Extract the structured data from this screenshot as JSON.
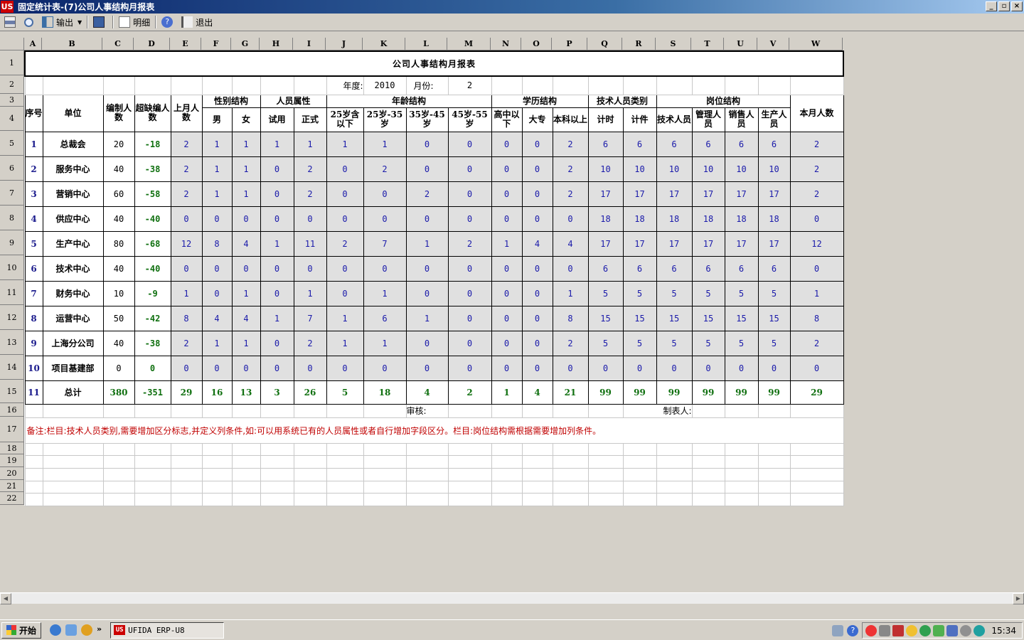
{
  "window": {
    "title": "固定统计表-(7)公司人事结构月报表",
    "logo": "US"
  },
  "toolbar": {
    "export_label": "输出",
    "detail_label": "明细",
    "exit_label": "退出"
  },
  "columns": [
    "A",
    "B",
    "C",
    "D",
    "E",
    "F",
    "G",
    "H",
    "I",
    "J",
    "K",
    "L",
    "M",
    "N",
    "O",
    "P",
    "Q",
    "R",
    "S",
    "T",
    "U",
    "V",
    "W"
  ],
  "rows": [
    "1",
    "2",
    "3",
    "4",
    "5",
    "6",
    "7",
    "8",
    "9",
    "10",
    "11",
    "12",
    "13",
    "14",
    "15",
    "16",
    "17",
    "18",
    "19",
    "20",
    "21",
    "22"
  ],
  "report": {
    "title": "公司人事结构月报表",
    "year_label": "年度:",
    "year": "2010",
    "month_label": "月份:",
    "month": "2",
    "headers": {
      "seq": "序号",
      "unit": "单位",
      "budget": "编制人数",
      "over": "超缺编人数",
      "last_month": "上月人数",
      "gender": "性别结构",
      "male": "男",
      "female": "女",
      "attr": "人员属性",
      "trial": "试用",
      "regular": "正式",
      "age": "年龄结构",
      "age1": "25岁含以下",
      "age2": "25岁-35岁",
      "age3": "35岁-45岁",
      "age4": "45岁-55岁",
      "edu": "学历结构",
      "edu1": "高中以下",
      "edu2": "大专",
      "edu3": "本科以上",
      "tech": "技术人员类别",
      "tech1": "计时",
      "tech2": "计件",
      "post": "岗位结构",
      "post1": "技术人员",
      "post2": "管理人员",
      "post3": "销售人员",
      "post4": "生产人员",
      "this_month": "本月人数"
    },
    "data_rows": [
      {
        "seq": "1",
        "unit": "总裁会",
        "v": [
          "20",
          "-18",
          "2",
          "1",
          "1",
          "1",
          "1",
          "1",
          "1",
          "0",
          "0",
          "0",
          "0",
          "2",
          "6",
          "6",
          "6",
          "6",
          "6",
          "6",
          "2"
        ]
      },
      {
        "seq": "2",
        "unit": "服务中心",
        "v": [
          "40",
          "-38",
          "2",
          "1",
          "1",
          "0",
          "2",
          "0",
          "2",
          "0",
          "0",
          "0",
          "0",
          "2",
          "10",
          "10",
          "10",
          "10",
          "10",
          "10",
          "2"
        ]
      },
      {
        "seq": "3",
        "unit": "营销中心",
        "v": [
          "60",
          "-58",
          "2",
          "1",
          "1",
          "0",
          "2",
          "0",
          "0",
          "2",
          "0",
          "0",
          "0",
          "2",
          "17",
          "17",
          "17",
          "17",
          "17",
          "17",
          "2"
        ]
      },
      {
        "seq": "4",
        "unit": "供应中心",
        "v": [
          "40",
          "-40",
          "0",
          "0",
          "0",
          "0",
          "0",
          "0",
          "0",
          "0",
          "0",
          "0",
          "0",
          "0",
          "18",
          "18",
          "18",
          "18",
          "18",
          "18",
          "0"
        ]
      },
      {
        "seq": "5",
        "unit": "生产中心",
        "v": [
          "80",
          "-68",
          "12",
          "8",
          "4",
          "1",
          "11",
          "2",
          "7",
          "1",
          "2",
          "1",
          "4",
          "4",
          "17",
          "17",
          "17",
          "17",
          "17",
          "17",
          "12"
        ]
      },
      {
        "seq": "6",
        "unit": "技术中心",
        "v": [
          "40",
          "-40",
          "0",
          "0",
          "0",
          "0",
          "0",
          "0",
          "0",
          "0",
          "0",
          "0",
          "0",
          "0",
          "6",
          "6",
          "6",
          "6",
          "6",
          "6",
          "0"
        ]
      },
      {
        "seq": "7",
        "unit": "财务中心",
        "v": [
          "10",
          "-9",
          "1",
          "0",
          "1",
          "0",
          "1",
          "0",
          "1",
          "0",
          "0",
          "0",
          "0",
          "1",
          "5",
          "5",
          "5",
          "5",
          "5",
          "5",
          "1"
        ]
      },
      {
        "seq": "8",
        "unit": "运营中心",
        "v": [
          "50",
          "-42",
          "8",
          "4",
          "4",
          "1",
          "7",
          "1",
          "6",
          "1",
          "0",
          "0",
          "0",
          "8",
          "15",
          "15",
          "15",
          "15",
          "15",
          "15",
          "8"
        ]
      },
      {
        "seq": "9",
        "unit": "上海分公司",
        "v": [
          "40",
          "-38",
          "2",
          "1",
          "1",
          "0",
          "2",
          "1",
          "1",
          "0",
          "0",
          "0",
          "0",
          "2",
          "5",
          "5",
          "5",
          "5",
          "5",
          "5",
          "2"
        ]
      },
      {
        "seq": "10",
        "unit": "项目基建部",
        "v": [
          "0",
          "0",
          "0",
          "0",
          "0",
          "0",
          "0",
          "0",
          "0",
          "0",
          "0",
          "0",
          "0",
          "0",
          "0",
          "0",
          "0",
          "0",
          "0",
          "0",
          "0"
        ]
      }
    ],
    "total": {
      "seq": "11",
      "unit": "总计",
      "v": [
        "380",
        "-351",
        "29",
        "16",
        "13",
        "3",
        "26",
        "5",
        "18",
        "4",
        "2",
        "1",
        "4",
        "21",
        "99",
        "99",
        "99",
        "99",
        "99",
        "99",
        "29"
      ]
    },
    "review_label": "审核:",
    "maker_label": "制表人:",
    "note": "备注:栏目:技术人员类别,需要增加区分标志,并定义列条件,如:可以用系统已有的人员属性或者自行增加字段区分。栏目:岗位结构需根据需要增加列条件。"
  },
  "taskbar": {
    "start_label": "开始",
    "quicklaunch_more": "»",
    "task_label": "UFIDA ERP-U8",
    "clock": "15:34"
  }
}
